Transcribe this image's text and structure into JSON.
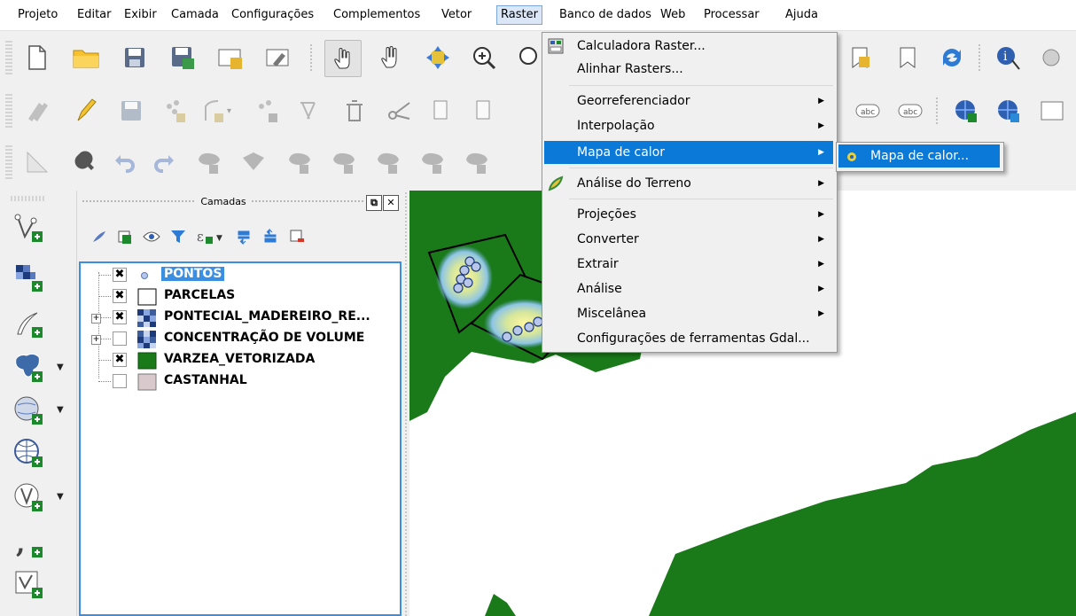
{
  "menubar": {
    "items": [
      "Projeto",
      "Editar",
      "Exibir",
      "Camada",
      "Configurações",
      "Complementos",
      "Vetor",
      "Raster",
      "Banco de dados",
      "Web",
      "Processar",
      "Ajuda"
    ],
    "open_item": "Raster"
  },
  "raster_menu": {
    "items": [
      {
        "label": "Calculadora Raster...",
        "icon": "raster-calculator-icon"
      },
      {
        "label": "Alinhar Rasters..."
      },
      {
        "label": "Georreferenciador",
        "submenu": true
      },
      {
        "label": "Interpolação",
        "submenu": true
      },
      {
        "label": "Mapa de calor",
        "submenu": true,
        "highlighted": true
      },
      {
        "label": "Análise do Terreno",
        "submenu": true,
        "icon": "terrain-analysis-icon"
      },
      {
        "label": "Projeções",
        "submenu": true
      },
      {
        "label": "Converter",
        "submenu": true
      },
      {
        "label": "Extrair",
        "submenu": true
      },
      {
        "label": "Análise",
        "submenu": true
      },
      {
        "label": "Miscelânea",
        "submenu": true
      },
      {
        "label": "Configurações de ferramentas Gdal..."
      }
    ]
  },
  "heatmap_submenu": {
    "items": [
      {
        "label": "Mapa de calor...",
        "icon": "heatmap-plugin-icon"
      }
    ]
  },
  "layers_panel": {
    "title": "Camadas",
    "layers": [
      {
        "name": "PONTOS",
        "checked": true,
        "selected": true,
        "symbol": "point"
      },
      {
        "name": "PARCELAS",
        "checked": true,
        "symbol": "white-fill"
      },
      {
        "name": "PONTECIAL_MADEREIRO_RE...",
        "checked": true,
        "symbol": "raster",
        "expandable": true
      },
      {
        "name": "CONCENTRAÇÃO DE VOLUME",
        "checked": false,
        "symbol": "raster",
        "expandable": true
      },
      {
        "name": "VARZEA_VETORIZADA",
        "checked": true,
        "symbol": "green-fill"
      },
      {
        "name": "CASTANHAL",
        "checked": false,
        "symbol": "pink-fill"
      }
    ]
  },
  "colors": {
    "accent": "#0a79d8",
    "selection": "#3b8fe3",
    "polygon_green": "#1a7a1a",
    "castanhal": "#d9c8cc"
  }
}
